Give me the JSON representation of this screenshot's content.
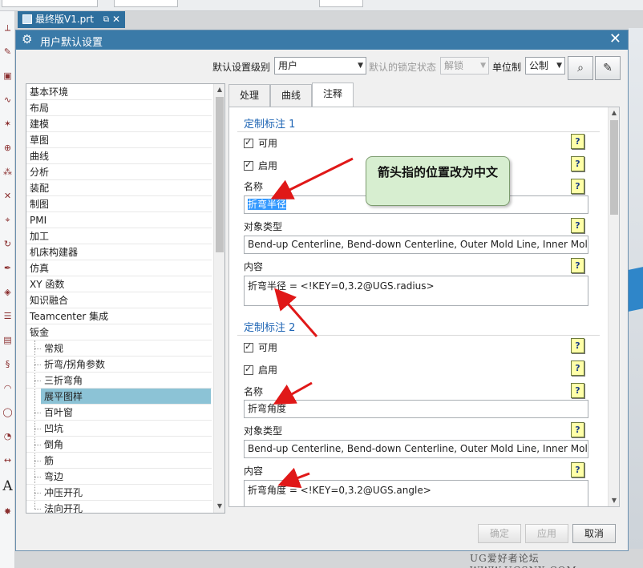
{
  "document_tab": {
    "title": "最终版V1.prt",
    "close": "✕"
  },
  "dialog": {
    "title": "用户默认设置",
    "close": "✕"
  },
  "toolbar": {
    "level_label": "默认设置级别",
    "level_value": "用户",
    "lock_label": "默认的锁定状态",
    "lock_value": "解锁",
    "unit_label": "单位制",
    "unit_value": "公制"
  },
  "tree": {
    "items": [
      {
        "label": "基本环境"
      },
      {
        "label": "布局"
      },
      {
        "label": "建模"
      },
      {
        "label": "草图"
      },
      {
        "label": "曲线"
      },
      {
        "label": "分析"
      },
      {
        "label": "装配"
      },
      {
        "label": "制图"
      },
      {
        "label": "PMI"
      },
      {
        "label": "加工"
      },
      {
        "label": "机床构建器"
      },
      {
        "label": "仿真"
      },
      {
        "label": "XY 函数"
      },
      {
        "label": "知识融合"
      },
      {
        "label": "Teamcenter 集成"
      },
      {
        "label": "钣金"
      },
      {
        "label": "常规"
      },
      {
        "label": "折弯/拐角参数"
      },
      {
        "label": "三折弯角"
      },
      {
        "label": "展平图样"
      },
      {
        "label": "百叶窗"
      },
      {
        "label": "凹坑"
      },
      {
        "label": "倒角"
      },
      {
        "label": "筋"
      },
      {
        "label": "弯边"
      },
      {
        "label": "冲压开孔"
      },
      {
        "label": "法向开孔"
      }
    ]
  },
  "tabs": [
    {
      "label": "处理"
    },
    {
      "label": "曲线"
    },
    {
      "label": "注释"
    }
  ],
  "sections": [
    {
      "title": "定制标注 1",
      "enabled_label": "可用",
      "active_label": "启用",
      "name_label": "名称",
      "name_value": "折弯半径",
      "type_label": "对象类型",
      "type_value": "Bend-up Centerline, Bend-down Centerline, Outer Mold Line, Inner Mold",
      "content_label": "内容",
      "content_value": "折弯半径 = <!KEY=0,3.2@UGS.radius>"
    },
    {
      "title": "定制标注 2",
      "enabled_label": "可用",
      "active_label": "启用",
      "name_label": "名称",
      "name_value": "折弯角度",
      "type_label": "对象类型",
      "type_value": "Bend-up Centerline, Bend-down Centerline, Outer Mold Line, Inner Mold",
      "content_label": "内容",
      "content_value": "折弯角度 = <!KEY=0,3.2@UGS.angle>"
    }
  ],
  "help_glyph": "?",
  "callout": "箭头指的位置改为中文",
  "buttons": {
    "ok": "确定",
    "apply": "应用",
    "cancel": "取消"
  },
  "watermark": "UG爱好者论坛 WWW.UGSNX.COM",
  "colors": {
    "title_bar": "#3a7aa8",
    "section_title": "#1d64b4",
    "tree_selected": "#8cc3d6",
    "arrow": "#e01818",
    "callout_bg": "#d7eed0"
  }
}
